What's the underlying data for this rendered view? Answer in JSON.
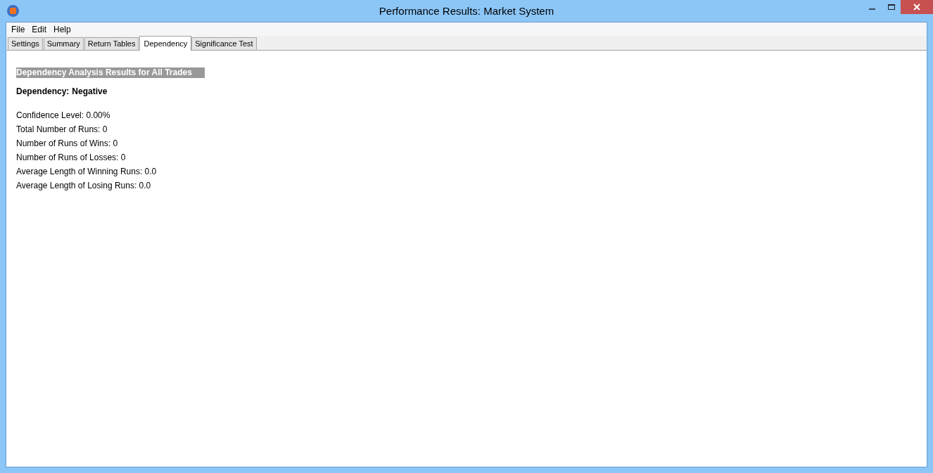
{
  "window": {
    "title": "Performance Results: Market System"
  },
  "menu": [
    "File",
    "Edit",
    "Help"
  ],
  "tabs": [
    {
      "label": "Settings",
      "selected": false
    },
    {
      "label": "Summary",
      "selected": false
    },
    {
      "label": "Return Tables",
      "selected": false
    },
    {
      "label": "Dependency",
      "selected": true
    },
    {
      "label": "Significance Test",
      "selected": false
    }
  ],
  "heading": "Dependency Analysis Results for All Trades",
  "dependency": {
    "label": "Dependency:",
    "value": "Negative"
  },
  "stats": [
    "Confidence Level: 0.00%",
    "Total Number of Runs: 0",
    "Number of Runs of Wins: 0",
    "Number of Runs of Losses: 0",
    "Average Length of Winning Runs: 0.0",
    "Average Length of Losing Runs: 0.0"
  ]
}
